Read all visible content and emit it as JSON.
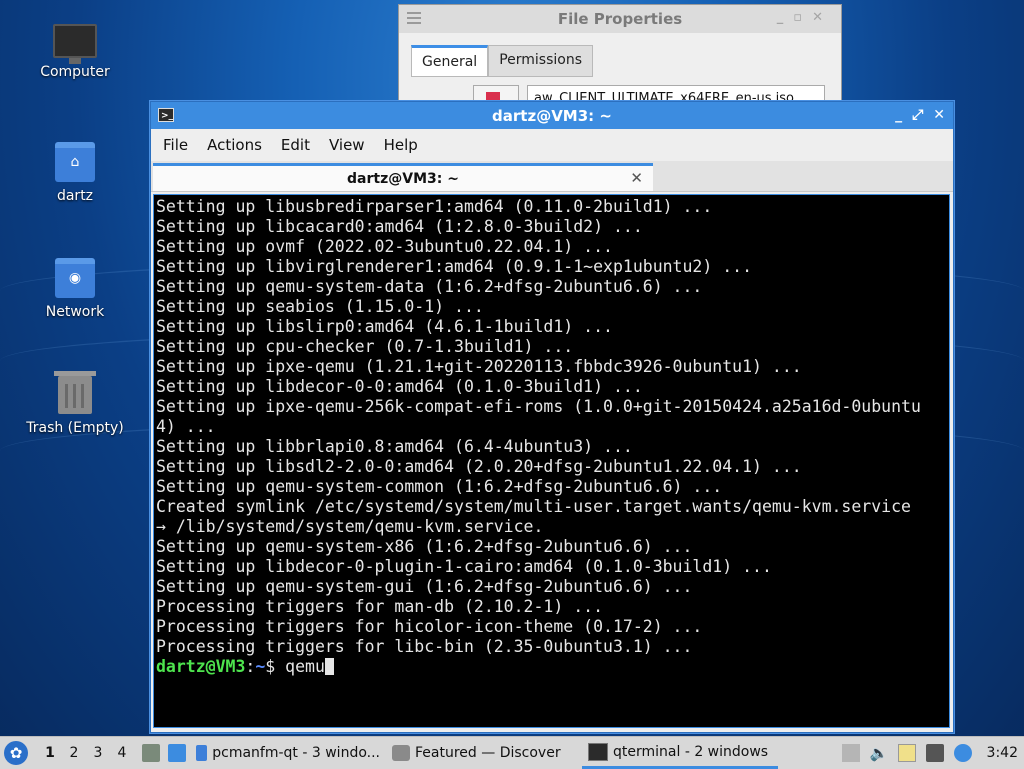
{
  "desktop": {
    "icons": [
      {
        "label": "Computer",
        "icon": "computer-icon"
      },
      {
        "label": "dartz",
        "icon": "home-folder-icon"
      },
      {
        "label": "Network",
        "icon": "network-folder-icon"
      },
      {
        "label": "Trash (Empty)",
        "icon": "trash-icon"
      }
    ]
  },
  "file_properties": {
    "title": "File Properties",
    "tabs": [
      "General",
      "Permissions"
    ],
    "active_tab": "General",
    "filename_value": "aw_CLIENT_ULTIMATE_x64FRE_en-us.iso"
  },
  "terminal": {
    "title": "dartz@VM3: ~",
    "menu": [
      "File",
      "Actions",
      "Edit",
      "View",
      "Help"
    ],
    "tab_label": "dartz@VM3: ~",
    "lines": [
      "Setting up libusbredirparser1:amd64 (0.11.0-2build1) ...",
      "Setting up libcacard0:amd64 (1:2.8.0-3build2) ...",
      "Setting up ovmf (2022.02-3ubuntu0.22.04.1) ...",
      "Setting up libvirglrenderer1:amd64 (0.9.1-1~exp1ubuntu2) ...",
      "Setting up qemu-system-data (1:6.2+dfsg-2ubuntu6.6) ...",
      "Setting up seabios (1.15.0-1) ...",
      "Setting up libslirp0:amd64 (4.6.1-1build1) ...",
      "Setting up cpu-checker (0.7-1.3build1) ...",
      "Setting up ipxe-qemu (1.21.1+git-20220113.fbbdc3926-0ubuntu1) ...",
      "Setting up libdecor-0-0:amd64 (0.1.0-3build1) ...",
      "Setting up ipxe-qemu-256k-compat-efi-roms (1.0.0+git-20150424.a25a16d-0ubuntu",
      "4) ...",
      "Setting up libbrlapi0.8:amd64 (6.4-4ubuntu3) ...",
      "Setting up libsdl2-2.0-0:amd64 (2.0.20+dfsg-2ubuntu1.22.04.1) ...",
      "Setting up qemu-system-common (1:6.2+dfsg-2ubuntu6.6) ...",
      "Created symlink /etc/systemd/system/multi-user.target.wants/qemu-kvm.service",
      "→ /lib/systemd/system/qemu-kvm.service.",
      "Setting up qemu-system-x86 (1:6.2+dfsg-2ubuntu6.6) ...",
      "Setting up libdecor-0-plugin-1-cairo:amd64 (0.1.0-3build1) ...",
      "Setting up qemu-system-gui (1:6.2+dfsg-2ubuntu6.6) ...",
      "Processing triggers for man-db (2.10.2-1) ...",
      "Processing triggers for hicolor-icon-theme (0.17-2) ...",
      "Processing triggers for libc-bin (2.35-0ubuntu3.1) ..."
    ],
    "prompt_user": "dartz@VM3",
    "prompt_sep": ":",
    "prompt_path": "~",
    "prompt_symbol": "$ ",
    "command": "qemu"
  },
  "taskbar": {
    "workspaces": [
      "1",
      "2",
      "3",
      "4"
    ],
    "active_workspace": "1",
    "tasks": [
      {
        "label": "pcmanfm-qt - 3 windo...",
        "icon": "folder-icon"
      },
      {
        "label": "Featured — Discover",
        "icon": "discover-icon"
      },
      {
        "label": "qterminal - 2 windows",
        "icon": "terminal-icon"
      }
    ],
    "clock": "3:42"
  },
  "colors": {
    "accent": "#3c8ce0",
    "prompt_user": "#4ee44e",
    "prompt_path": "#5a8cff"
  }
}
